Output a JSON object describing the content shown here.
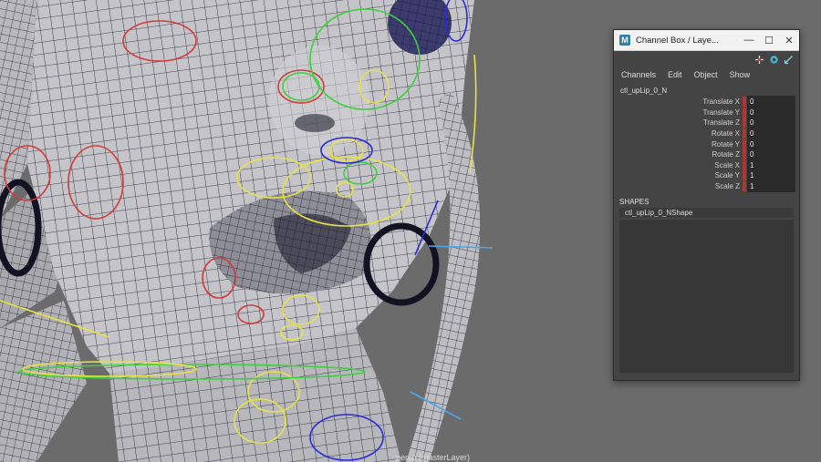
{
  "viewport": {
    "camera_label": "persp (masterLayer)"
  },
  "channel_box": {
    "title": "Channel Box / Laye...",
    "app_icon": "M",
    "window_controls": {
      "minimize": "—",
      "maximize": "☐",
      "close": "✕"
    },
    "toolbar_icons": [
      "move-tool-icon",
      "snap-icon",
      "edit-icon"
    ],
    "menu": [
      "Channels",
      "Edit",
      "Object",
      "Show"
    ],
    "node_name": "ctl_upLip_0_N",
    "attributes": [
      {
        "label": "Translate X",
        "value": "0"
      },
      {
        "label": "Translate Y",
        "value": "0"
      },
      {
        "label": "Translate Z",
        "value": "0"
      },
      {
        "label": "Rotate X",
        "value": "0"
      },
      {
        "label": "Rotate Y",
        "value": "0"
      },
      {
        "label": "Rotate Z",
        "value": "0"
      },
      {
        "label": "Scale X",
        "value": "1"
      },
      {
        "label": "Scale Y",
        "value": "1"
      },
      {
        "label": "Scale Z",
        "value": "1"
      }
    ],
    "shapes_header": "SHAPES",
    "shape_item": "ctl_upLip_0_NShape",
    "colors": {
      "keyed_marker": "#b23535",
      "panel_bg": "#444444"
    }
  }
}
